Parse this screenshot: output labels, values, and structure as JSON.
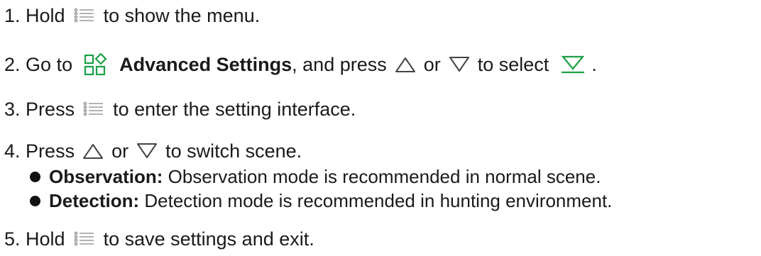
{
  "steps": [
    {
      "num": "1.",
      "before": "Hold",
      "after": "to show the menu."
    },
    {
      "num": "2.",
      "before": "Go to",
      "menu": "Advanced Settings",
      "mid": ", and press",
      "or": "or",
      "to_select": "to select",
      "end": "."
    },
    {
      "num": "3.",
      "before": "Press",
      "after": "to enter the setting interface."
    },
    {
      "num": "4.",
      "before": "Press",
      "or": "or",
      "after": "to switch scene."
    },
    {
      "num": "5.",
      "before": "Hold",
      "after": "to save settings and exit."
    }
  ],
  "bullets": [
    {
      "term": "Observation:",
      "desc": "Observation mode is recommended in normal scene."
    },
    {
      "term": "Detection:",
      "desc": "Detection mode is recommended in hunting environment."
    }
  ],
  "colors": {
    "accent": "#1aa047",
    "text": "#1a1a1a",
    "icon_gray": "#9a9a9a"
  },
  "icons": {
    "menu": "menu-list-icon",
    "advanced": "advanced-settings-icon",
    "up": "up-triangle-icon",
    "down": "down-triangle-icon",
    "scene": "scene-mode-icon"
  }
}
